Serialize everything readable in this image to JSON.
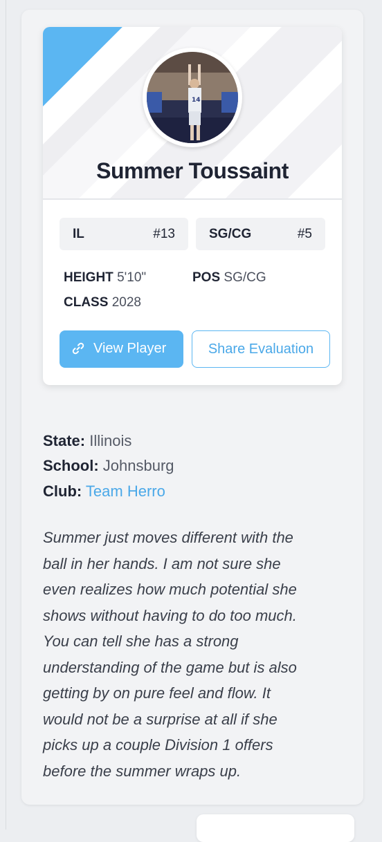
{
  "player": {
    "name": "Summer Toussaint",
    "state_abbr": "IL",
    "state_rank": "#13",
    "position_group": "SG/CG",
    "position_rank": "#5",
    "stats": {
      "height_label": "HEIGHT",
      "height_value": "5'10\"",
      "pos_label": "POS",
      "pos_value": "SG/CG",
      "class_label": "CLASS",
      "class_value": "2028"
    },
    "photo_jersey_number": "14"
  },
  "actions": {
    "view_player_label": "View Player",
    "share_evaluation_label": "Share Evaluation"
  },
  "details": {
    "state_label": "State:",
    "state_value": "Illinois",
    "school_label": "School:",
    "school_value": "Johnsburg",
    "club_label": "Club:",
    "club_value": "Team Herro"
  },
  "evaluation_lines": [
    "Summer just moves different with the",
    "ball in her hands. I am not sure she",
    "even realizes how much potential she",
    "shows without having to do too much.",
    "You can tell she has a strong",
    "understanding of the game but is also",
    "getting by on pure feel and flow. It",
    "would not be a surprise at all if she",
    "picks up a couple Division 1 offers",
    "before the summer wraps up."
  ],
  "colors": {
    "accent": "#5bb6f2",
    "link": "#4aa8e8",
    "name_text": "#1f2433",
    "card_bg": "#ffffff",
    "page_bg": "#eceef1"
  },
  "icons": {
    "view_player": "link-icon"
  }
}
